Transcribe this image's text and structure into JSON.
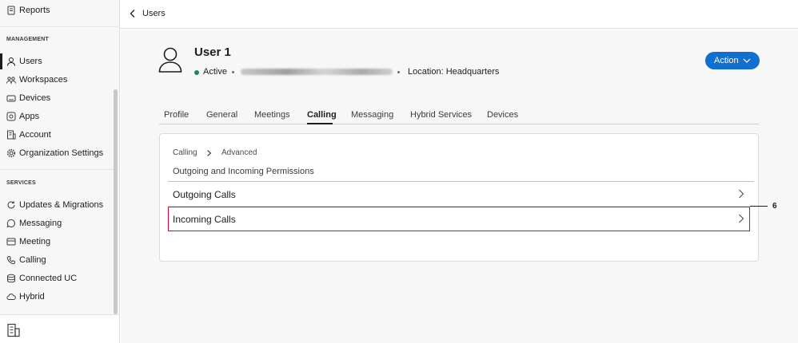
{
  "sidebar": {
    "reports_label": "Reports",
    "management_heading": "MANAGEMENT",
    "management_items": [
      {
        "label": "Users",
        "icon": "user-icon"
      },
      {
        "label": "Workspaces",
        "icon": "workspaces-icon"
      },
      {
        "label": "Devices",
        "icon": "devices-icon"
      },
      {
        "label": "Apps",
        "icon": "apps-icon"
      },
      {
        "label": "Account",
        "icon": "account-icon"
      },
      {
        "label": "Organization Settings",
        "icon": "gear-icon"
      }
    ],
    "services_heading": "SERVICES",
    "services_items": [
      {
        "label": "Updates & Migrations",
        "icon": "refresh-icon"
      },
      {
        "label": "Messaging",
        "icon": "chat-icon"
      },
      {
        "label": "Meeting",
        "icon": "meeting-icon"
      },
      {
        "label": "Calling",
        "icon": "phone-icon"
      },
      {
        "label": "Connected UC",
        "icon": "database-icon"
      },
      {
        "label": "Hybrid",
        "icon": "cloud-icon"
      }
    ],
    "active_item": "Users"
  },
  "header": {
    "breadcrumb": "Users"
  },
  "user": {
    "name": "User 1",
    "status": "Active",
    "status_color": "#1b875b",
    "location": "Location: Headquarters"
  },
  "action_button": {
    "label": "Action",
    "color": "#1170cf"
  },
  "tabs": [
    {
      "label": "Profile"
    },
    {
      "label": "General"
    },
    {
      "label": "Meetings"
    },
    {
      "label": "Calling"
    },
    {
      "label": "Messaging"
    },
    {
      "label": "Hybrid Services"
    },
    {
      "label": "Devices"
    }
  ],
  "active_tab": "Calling",
  "panel": {
    "breadcrumb_parent": "Calling",
    "breadcrumb_current": "Advanced",
    "section_title": "Outgoing and Incoming Permissions",
    "rows": [
      {
        "label": "Outgoing Calls"
      },
      {
        "label": "Incoming Calls"
      }
    ]
  },
  "callout": {
    "number": "6",
    "color": "#e4002b"
  }
}
